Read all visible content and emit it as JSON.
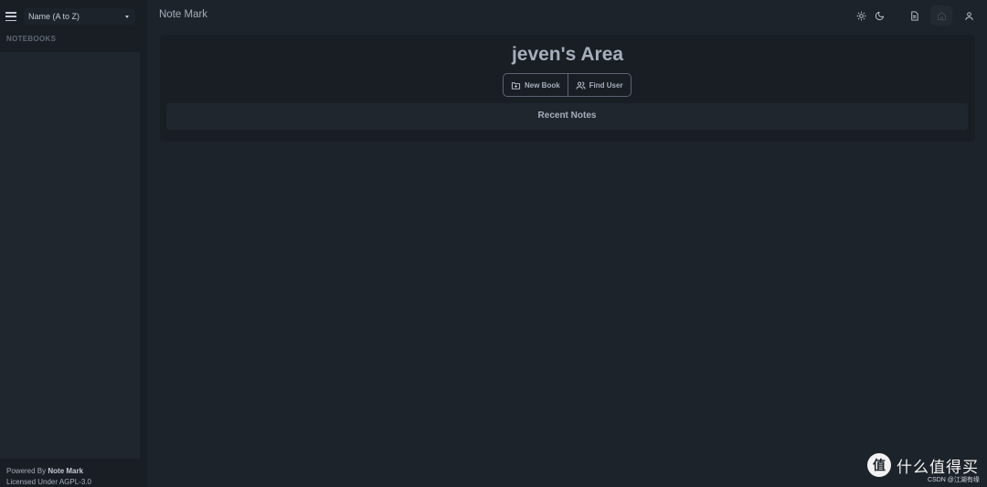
{
  "sidebar": {
    "sort_label": "Name (A to Z)",
    "heading": "NOTEBOOKS",
    "footer": {
      "powered_prefix": "Powered By",
      "powered_brand": "Note Mark",
      "license": "Licensed Under AGPL-3.0"
    }
  },
  "header": {
    "app_title": "Note Mark",
    "icons": [
      "sun-icon",
      "moon-icon",
      "document-icon",
      "home-icon",
      "user-icon"
    ]
  },
  "main": {
    "title": "jeven's Area",
    "buttons": {
      "new_book": "New Book",
      "find_user": "Find User"
    },
    "recent_notes_heading": "Recent Notes"
  },
  "watermark": {
    "logo_char": "值",
    "text": "什么值得买",
    "sub": "CSDN @江湖有缘"
  },
  "colors": {
    "background": "#1d232a",
    "panel": "#191e24",
    "text": "#a6adbb"
  }
}
